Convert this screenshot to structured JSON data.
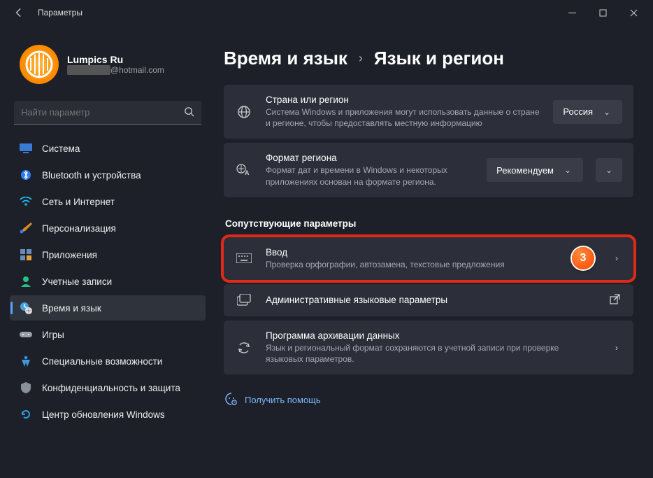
{
  "window": {
    "title": "Параметры"
  },
  "profile": {
    "name": "Lumpics Ru",
    "email_domain": "@hotmail.com"
  },
  "search": {
    "placeholder": "Найти параметр"
  },
  "sidebar": {
    "items": [
      {
        "label": "Система"
      },
      {
        "label": "Bluetooth и устройства"
      },
      {
        "label": "Сеть и Интернет"
      },
      {
        "label": "Персонализация"
      },
      {
        "label": "Приложения"
      },
      {
        "label": "Учетные записи"
      },
      {
        "label": "Время и язык"
      },
      {
        "label": "Игры"
      },
      {
        "label": "Специальные возможности"
      },
      {
        "label": "Конфиденциальность и защита"
      },
      {
        "label": "Центр обновления Windows"
      }
    ]
  },
  "breadcrumb": {
    "parent": "Время и язык",
    "current": "Язык и регион"
  },
  "cards": {
    "country": {
      "title": "Страна или регион",
      "sub": "Система Windows и приложения могут использовать данные о стране и регионе, чтобы предоставлять местную информацию",
      "value": "Россия"
    },
    "format": {
      "title": "Формат региона",
      "sub": "Формат дат и времени в Windows и некоторых приложениях основан на формате региона.",
      "value": "Рекомендуем"
    }
  },
  "related": {
    "header": "Сопутствующие параметры",
    "input": {
      "title": "Ввод",
      "sub": "Проверка орфографии, автозамена, текстовые предложения",
      "marker": "3"
    },
    "admin": {
      "title": "Административные языковые параметры"
    },
    "archive": {
      "title": "Программа архивации данных",
      "sub": "Язык и региональный формат сохраняются в учетной записи при проверке языковых параметров."
    }
  },
  "help": {
    "label": "Получить помощь"
  }
}
